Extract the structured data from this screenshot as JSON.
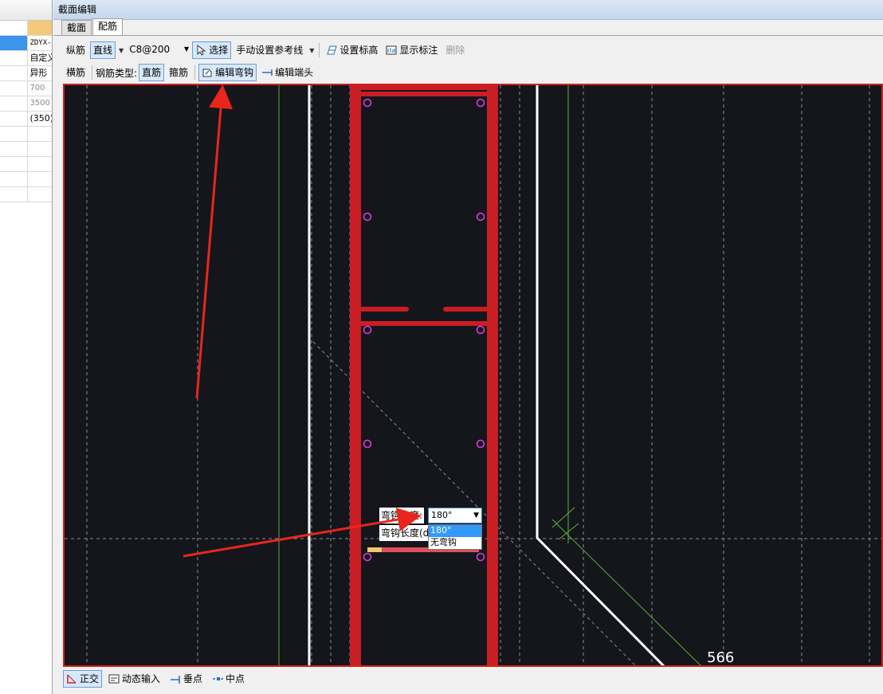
{
  "left_panel": {
    "rows": [
      {
        "value": "ZDYX-",
        "selected": true
      },
      {
        "value": "自定义"
      },
      {
        "value": "异形"
      },
      {
        "value": "700",
        "muted": true
      },
      {
        "value": "3500",
        "muted": true
      },
      {
        "value": "(350)"
      },
      {
        "value": ""
      },
      {
        "value": ""
      },
      {
        "value": ""
      },
      {
        "value": ""
      },
      {
        "value": ""
      }
    ]
  },
  "window": {
    "title": "截面编辑",
    "tabs": [
      {
        "label": "截面",
        "active": false
      },
      {
        "label": "配筋",
        "active": true
      }
    ]
  },
  "toolbar1": {
    "longitudinal": "纵筋",
    "line_mode": "直线",
    "rebar_spec": "C8@200",
    "select": "选择",
    "manual_ref_line": "手动设置参考线",
    "set_elevation": "设置标高",
    "show_annotation": "显示标注",
    "delete": "删除"
  },
  "toolbar2": {
    "transverse": "横筋",
    "rebar_type_label": "钢筋类型:",
    "straight": "直筋",
    "stirrup": "箍筋",
    "edit_hook": "编辑弯钩",
    "edit_end": "编辑端头"
  },
  "hook_popup": {
    "angle_label": "弯钩角度:",
    "angle_value": "180°",
    "length_label": "弯钩长度(d)",
    "options": [
      "180°",
      "无弯钩"
    ]
  },
  "canvas": {
    "dimension_label": "566",
    "colors": {
      "background": "#14161c",
      "rebar": "#c81e24",
      "node": "#e23be6",
      "wall": "#ffffff",
      "grid": "#8a8f99",
      "guide": "#5fae3c",
      "annotation_arrow": "#e8261c"
    }
  },
  "statusbar": {
    "ortho": "正交",
    "dynamic_input": "动态输入",
    "perpendicular": "垂点",
    "midpoint": "中点"
  }
}
